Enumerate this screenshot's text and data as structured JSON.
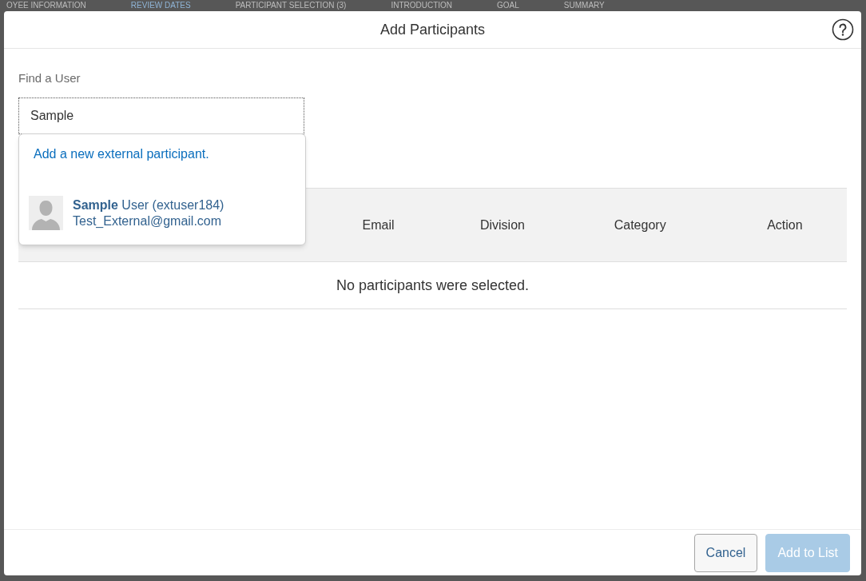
{
  "background_tabs": [
    {
      "label": "OYEE INFORMATION",
      "selected": false
    },
    {
      "label": "REVIEW DATES",
      "selected": true
    },
    {
      "label": "PARTICIPANT SELECTION (3)",
      "selected": false
    },
    {
      "label": "INTRODUCTION",
      "selected": false
    },
    {
      "label": "GOAL",
      "selected": false
    },
    {
      "label": "SUMMARY",
      "selected": false
    }
  ],
  "dialog": {
    "title": "Add Participants",
    "find_label": "Find a User",
    "search_value": "Sample",
    "suggestions": {
      "add_external": "Add a new external participant.",
      "users": [
        {
          "name": "**Sample** User (extuser184)",
          "email": "Test_External@gmail.com"
        }
      ]
    },
    "table": {
      "columns": [
        "Email",
        "Division",
        "Category",
        "Action"
      ],
      "empty_message": "No participants were selected."
    },
    "buttons": [
      {
        "label": "Cancel",
        "kind": "secondary",
        "disabled": false
      },
      {
        "label": "Add to List",
        "kind": "primary",
        "disabled": true
      }
    ]
  }
}
